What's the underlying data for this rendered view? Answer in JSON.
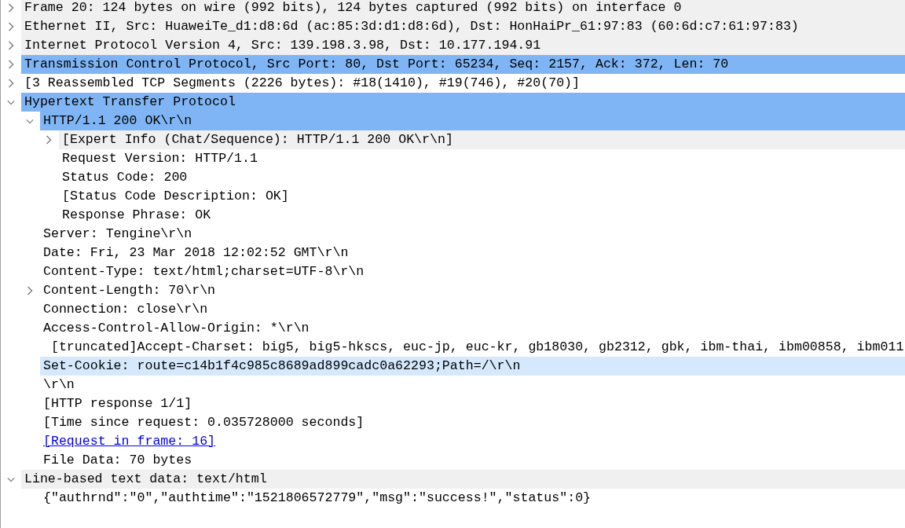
{
  "tree": [
    {
      "kind": "protocol",
      "text": "Frame 20: 124 bytes on wire (992 bits), 124 bytes captured (992 bits) on interface 0",
      "expanded": false,
      "selected": false,
      "hovered": false
    },
    {
      "kind": "protocol",
      "text": "Ethernet II, Src: HuaweiTe_d1:d8:6d (ac:85:3d:d1:d8:6d), Dst: HonHaiPr_61:97:83 (60:6d:c7:61:97:83)",
      "expanded": false,
      "selected": false,
      "hovered": false
    },
    {
      "kind": "protocol",
      "text": "Internet Protocol Version 4, Src: 139.198.3.98, Dst: 10.177.194.91",
      "expanded": false,
      "selected": false,
      "hovered": false
    },
    {
      "kind": "protocol",
      "text": "Transmission Control Protocol, Src Port: 80, Dst Port: 65234, Seq: 2157, Ack: 372, Len: 70",
      "expanded": false,
      "selected": true,
      "hovered": false
    },
    {
      "kind": "field",
      "text": "[3 Reassembled TCP Segments (2226 bytes): #18(1410), #19(746), #20(70)]",
      "expanded": false,
      "selected": false,
      "hovered": false
    },
    {
      "kind": "protocol",
      "text": "Hypertext Transfer Protocol",
      "expanded": true,
      "selected": true,
      "hovered": false,
      "children": [
        {
          "kind": "field",
          "text": "HTTP/1.1 200 OK\\r\\n",
          "expanded": true,
          "selected": true,
          "hovered": false,
          "children": [
            {
              "kind": "expert",
              "text": "[Expert Info (Chat/Sequence): HTTP/1.1 200 OK\\r\\n]",
              "expanded": false,
              "selected": false,
              "hovered": false
            },
            {
              "kind": "field",
              "text": "Request Version: HTTP/1.1",
              "selected": false,
              "hovered": false
            },
            {
              "kind": "field",
              "text": "Status Code: 200",
              "selected": false,
              "hovered": false
            },
            {
              "kind": "field",
              "text": "[Status Code Description: OK]",
              "selected": false,
              "hovered": false
            },
            {
              "kind": "field",
              "text": "Response Phrase: OK",
              "selected": false,
              "hovered": false
            }
          ]
        },
        {
          "kind": "field",
          "text": "Server: Tengine\\r\\n",
          "selected": false,
          "hovered": false
        },
        {
          "kind": "field",
          "text": "Date: Fri, 23 Mar 2018 12:02:52 GMT\\r\\n",
          "selected": false,
          "hovered": false
        },
        {
          "kind": "field",
          "text": "Content-Type: text/html;charset=UTF-8\\r\\n",
          "selected": false,
          "hovered": false
        },
        {
          "kind": "field",
          "text": "Content-Length: 70\\r\\n",
          "expanded": false,
          "selected": false,
          "hovered": false
        },
        {
          "kind": "field",
          "text": "Connection: close\\r\\n",
          "selected": false,
          "hovered": false
        },
        {
          "kind": "field",
          "text": "Access-Control-Allow-Origin: *\\r\\n",
          "selected": false,
          "hovered": false
        },
        {
          "kind": "field",
          "text": " [truncated]Accept-Charset: big5, big5-hkscs, euc-jp, euc-kr, gb18030, gb2312, gbk, ibm-thai, ibm00858, ibm011",
          "selected": false,
          "hovered": false
        },
        {
          "kind": "field",
          "text": "Set-Cookie: route=c14b1f4c985c8689ad899cadc0a62293;Path=/\\r\\n",
          "selected": false,
          "hovered": true
        },
        {
          "kind": "field",
          "text": "\\r\\n",
          "selected": false,
          "hovered": false
        },
        {
          "kind": "field",
          "text": "[HTTP response 1/1]",
          "selected": false,
          "hovered": false
        },
        {
          "kind": "field",
          "text": "[Time since request: 0.035728000 seconds]",
          "selected": false,
          "hovered": false
        },
        {
          "kind": "link",
          "text": "[Request in frame: 16]",
          "selected": false,
          "hovered": false
        },
        {
          "kind": "field",
          "text": "File Data: 70 bytes",
          "selected": false,
          "hovered": false
        }
      ]
    },
    {
      "kind": "protocol",
      "text": "Line-based text data: text/html",
      "expanded": true,
      "selected": false,
      "hovered": false,
      "children": [
        {
          "kind": "field",
          "text": "{\"authrnd\":\"0\",\"authtime\":\"1521806572779\",\"msg\":\"success!\",\"status\":0}",
          "selected": false,
          "hovered": false
        }
      ]
    }
  ]
}
